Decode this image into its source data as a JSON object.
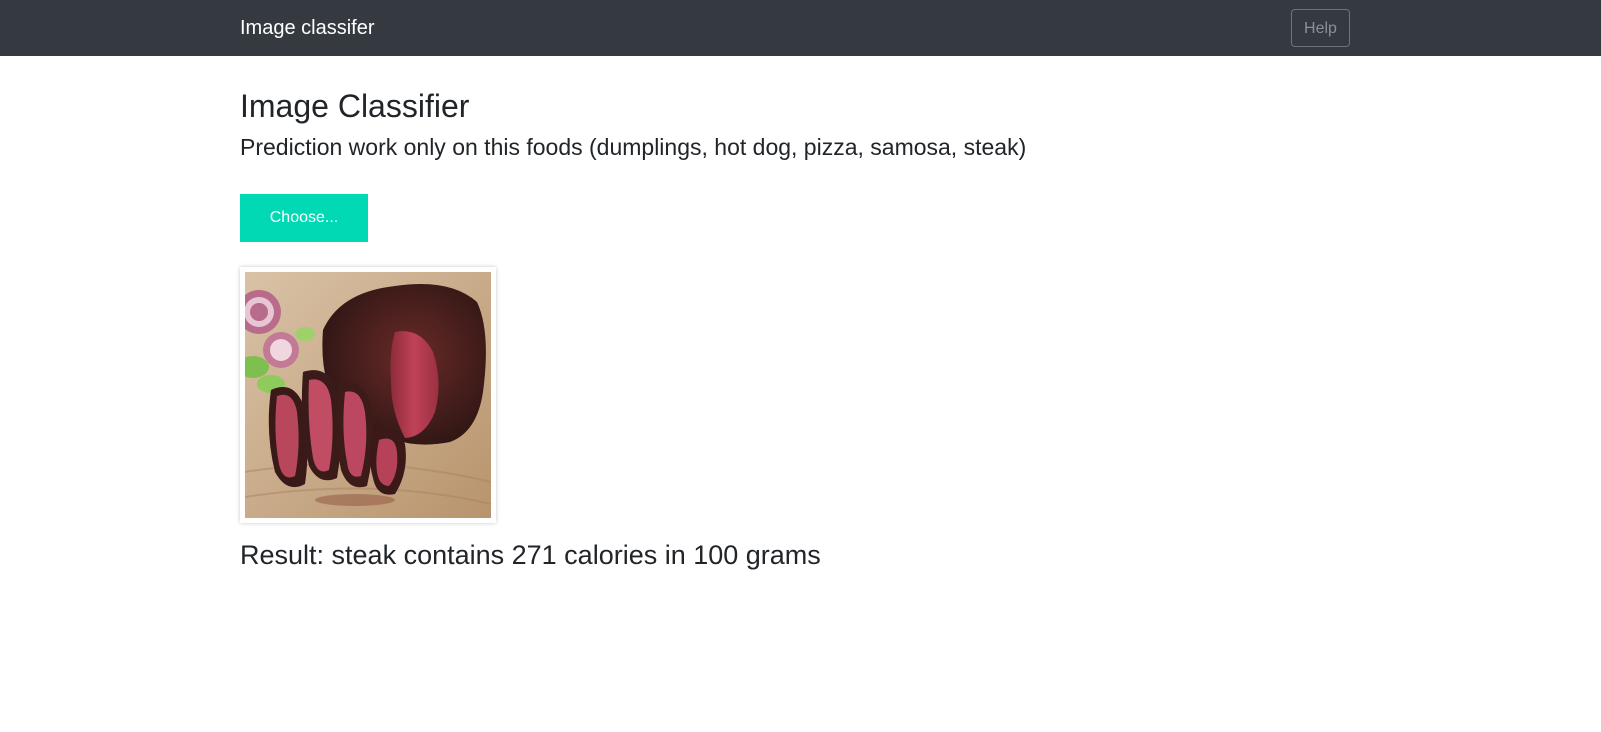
{
  "navbar": {
    "brand": "Image classifer",
    "help_label": "Help"
  },
  "main": {
    "title": "Image Classifier",
    "subtitle": "Prediction work only on this foods (dumplings, hot dog, pizza, samosa, steak)",
    "choose_label": "Choose...",
    "result_text": "Result: steak contains 271 calories in 100 grams"
  },
  "colors": {
    "navbar_bg": "#343a40",
    "choose_button": "#00d9b4"
  },
  "icons": {
    "preview": "steak-photo"
  }
}
